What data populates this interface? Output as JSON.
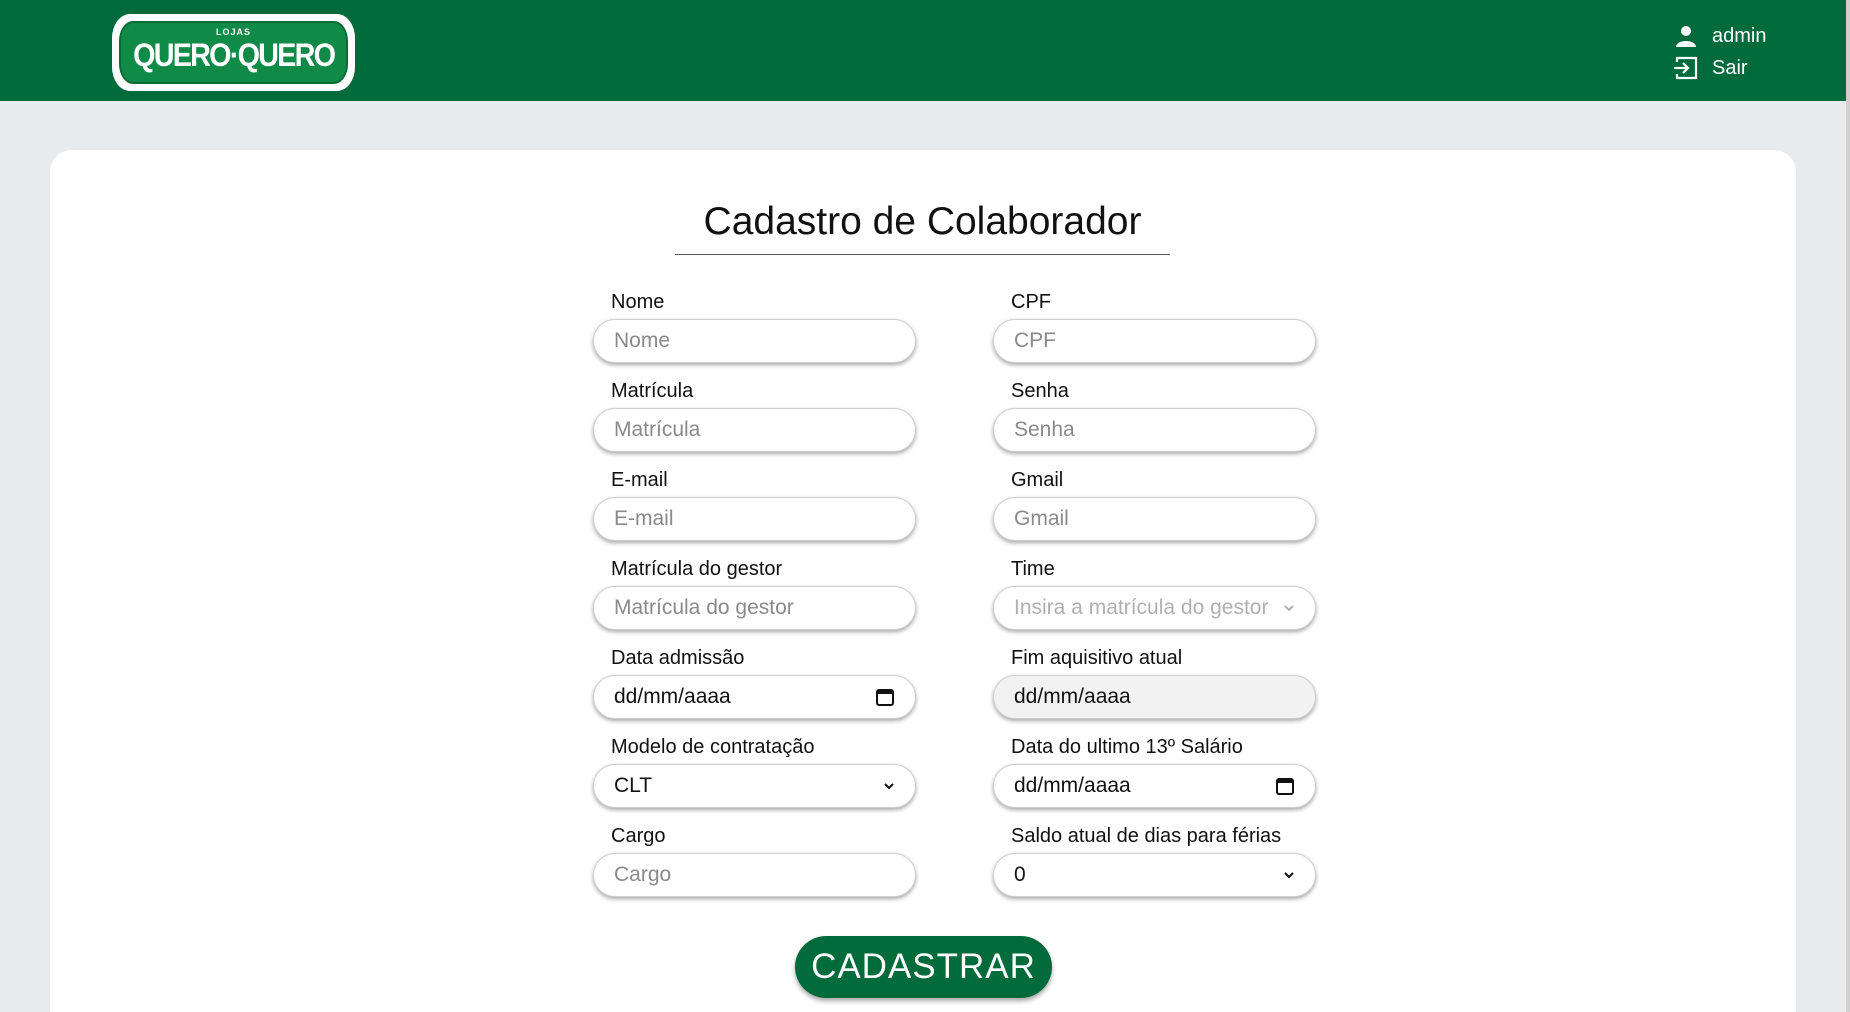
{
  "header": {
    "brand_top": "LOJAS",
    "brand": "QUERO·QUERO",
    "user": "admin",
    "logout": "Sair"
  },
  "form": {
    "title": "Cadastro de Colaborador",
    "left": [
      {
        "label": "Nome",
        "placeholder": "Nome",
        "value": ""
      },
      {
        "label": "Matrícula",
        "placeholder": "Matrícula",
        "value": ""
      },
      {
        "label": "E-mail",
        "placeholder": "E-mail",
        "value": ""
      },
      {
        "label": "Matrícula do gestor",
        "placeholder": "Matrícula do gestor",
        "value": ""
      },
      {
        "label": "Data admissão",
        "value": "dd/mm/aaaa"
      },
      {
        "label": "Modelo de contratação",
        "value": "CLT"
      },
      {
        "label": "Cargo",
        "placeholder": "Cargo",
        "value": ""
      }
    ],
    "right": [
      {
        "label": "CPF",
        "placeholder": "CPF",
        "value": ""
      },
      {
        "label": "Senha",
        "placeholder": "Senha",
        "value": ""
      },
      {
        "label": "Gmail",
        "placeholder": "Gmail",
        "value": ""
      },
      {
        "label": "Time",
        "placeholder": "Insira a matrícula do gestor",
        "value": ""
      },
      {
        "label": "Fim aquisitivo atual",
        "value": "dd/mm/aaaa"
      },
      {
        "label": "Data do ultimo 13º Salário",
        "value": "dd/mm/aaaa"
      },
      {
        "label": "Saldo atual de dias para férias",
        "value": "0"
      }
    ],
    "submit": "CADASTRAR"
  },
  "colors": {
    "brand_green": "#016b3b",
    "page_bg": "#e8ebee"
  },
  "icons": [
    "user-icon",
    "logout-icon",
    "calendar-icon",
    "chevron-down-icon"
  ]
}
